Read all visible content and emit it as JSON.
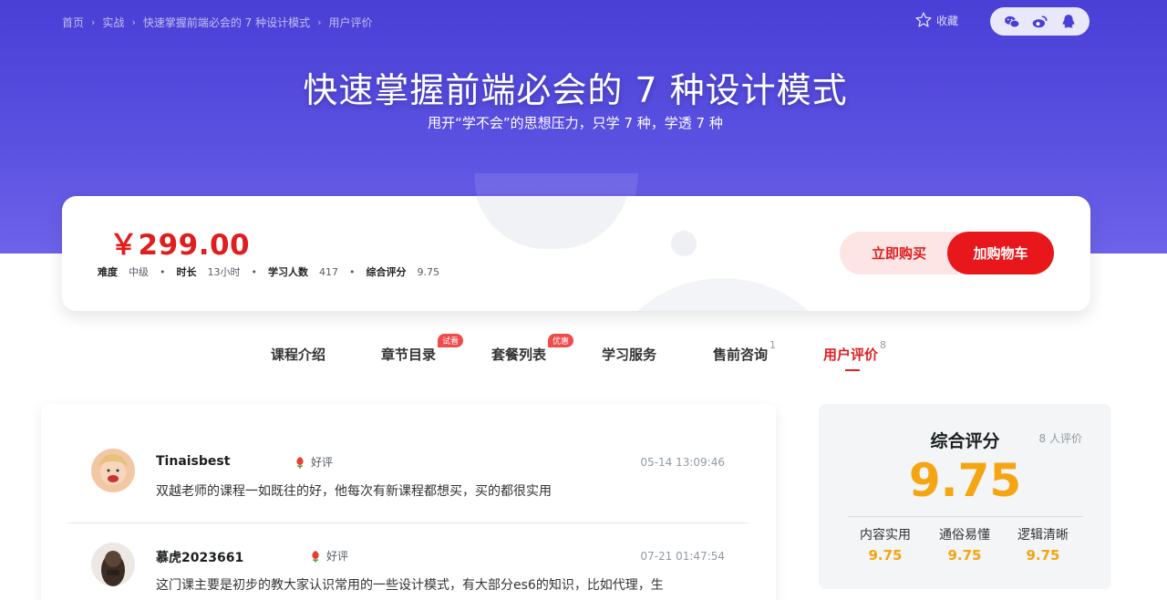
{
  "breadcrumb": [
    "首页",
    "实战",
    "快速掌握前端必会的 7 种设计模式",
    "用户评价"
  ],
  "favorite_label": "收藏",
  "share_icons": [
    "wechat-icon",
    "weibo-icon",
    "qq-icon"
  ],
  "course": {
    "title": "快速掌握前端必会的 7 种设计模式",
    "subtitle": "甩开“学不会”的思想压力，只学 7 种，学透 7 种",
    "price": "￥299.00",
    "stats": [
      {
        "key": "难度",
        "value": "中级"
      },
      {
        "key": "时长",
        "value": "13小时"
      },
      {
        "key": "学习人数",
        "value": "417"
      },
      {
        "key": "综合评分",
        "value": "9.75"
      }
    ],
    "buy_now": "立即购买",
    "add_cart": "加购物车"
  },
  "tabs": [
    {
      "label": "课程介绍",
      "tag": "",
      "sup": ""
    },
    {
      "label": "章节目录",
      "tag": "试看",
      "sup": ""
    },
    {
      "label": "套餐列表",
      "tag": "优惠",
      "sup": ""
    },
    {
      "label": "学习服务",
      "tag": "",
      "sup": ""
    },
    {
      "label": "售前咨询",
      "tag": "",
      "sup": "1"
    },
    {
      "label": "用户评价",
      "tag": "",
      "sup": "8"
    }
  ],
  "reviews": [
    {
      "user": "Tinaisbest",
      "rating": "好评",
      "time": "05-14 13:09:46",
      "content": "双越老师的课程一如既往的好，他每次有新课程都想买，买的都很实用"
    },
    {
      "user": "慕虎2023661",
      "rating": "好评",
      "time": "07-21 01:47:54",
      "content": "这门课主要是初步的教大家认识常用的一些设计模式，有大部分es6的知识，比如代理，生"
    }
  ],
  "summary": {
    "label": "综合评分",
    "count": "8 人评价",
    "score": "9.75",
    "subs": [
      {
        "label": "内容实用",
        "value": "9.75"
      },
      {
        "label": "通俗易懂",
        "value": "9.75"
      },
      {
        "label": "逻辑清晰",
        "value": "9.75"
      }
    ]
  },
  "colors": {
    "accent": "#e01e1e",
    "score": "#f4a511",
    "hero": "#4a3fd6"
  }
}
